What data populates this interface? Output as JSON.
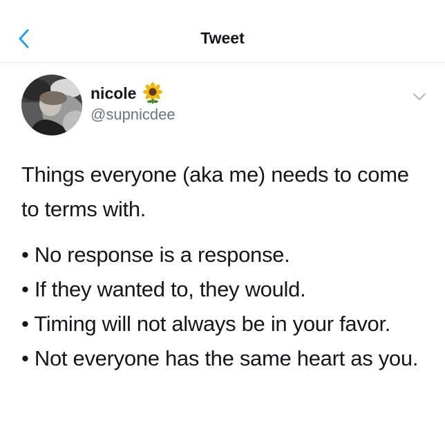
{
  "header": {
    "title": "Tweet",
    "back_icon": "chevron-left-icon",
    "accent_color": "#1da1f2"
  },
  "author": {
    "display_name": "nicole",
    "emoji": "sunflower",
    "handle": "@supnicdee"
  },
  "tweet": {
    "intro": "Things everyone (aka me) needs to come to terms with.",
    "bullets": [
      "• No response is a response.",
      "• If they wanted to, they would.",
      "• Timing will not always be in your favor.",
      "• Not everyone has the same heart as you."
    ]
  },
  "colors": {
    "text": "#14171a",
    "secondary_text": "#657786",
    "divider": "#e6ecf0"
  }
}
